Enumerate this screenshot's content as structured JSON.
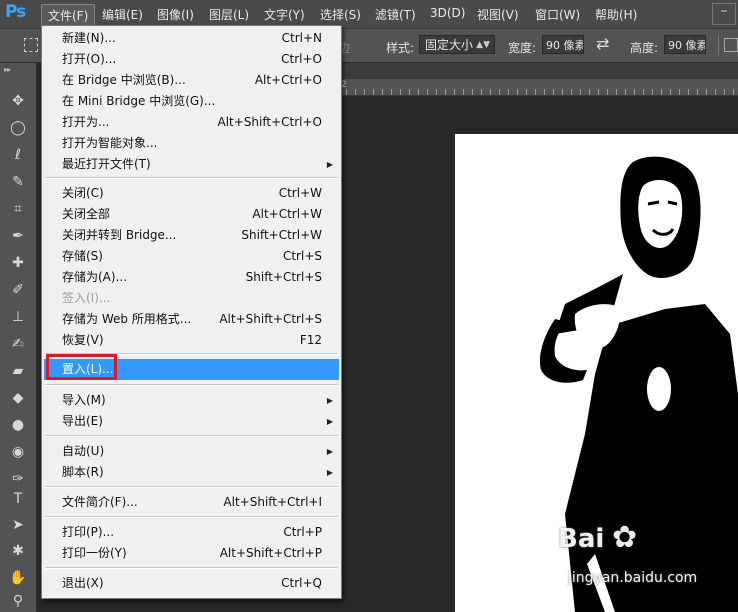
{
  "app": {
    "logo": "Ps"
  },
  "menubar": {
    "file": "文件(F)",
    "edit": "编辑(E)",
    "image": "图像(I)",
    "layer": "图层(L)",
    "type": "文字(Y)",
    "select": "选择(S)",
    "filter": "滤镜(T)",
    "threed": "3D(D)",
    "view": "视图(V)",
    "window": "窗口(W)",
    "help": "帮助(H)"
  },
  "options": {
    "refine_edge_partial": "边",
    "style_label": "样式:",
    "style_value": "固定大小",
    "width_label": "宽度:",
    "width_value": "90 像素",
    "height_label": "高度:",
    "height_value": "90 像素"
  },
  "file_menu": {
    "items": [
      {
        "label": "新建(N)...",
        "shortcut": "Ctrl+N"
      },
      {
        "label": "打开(O)...",
        "shortcut": "Ctrl+O"
      },
      {
        "label": "在 Bridge 中浏览(B)...",
        "shortcut": "Alt+Ctrl+O"
      },
      {
        "label": "在 Mini Bridge 中浏览(G)...",
        "shortcut": ""
      },
      {
        "label": "打开为...",
        "shortcut": "Alt+Shift+Ctrl+O"
      },
      {
        "label": "打开为智能对象...",
        "shortcut": ""
      },
      {
        "label": "最近打开文件(T)",
        "shortcut": ""
      },
      {
        "label": "关闭(C)",
        "shortcut": "Ctrl+W"
      },
      {
        "label": "关闭全部",
        "shortcut": "Alt+Ctrl+W"
      },
      {
        "label": "关闭并转到 Bridge...",
        "shortcut": "Shift+Ctrl+W"
      },
      {
        "label": "存储(S)",
        "shortcut": "Ctrl+S"
      },
      {
        "label": "存储为(A)...",
        "shortcut": "Shift+Ctrl+S"
      },
      {
        "label": "签入(I)...",
        "shortcut": ""
      },
      {
        "label": "存储为 Web 所用格式...",
        "shortcut": "Alt+Shift+Ctrl+S"
      },
      {
        "label": "恢复(V)",
        "shortcut": "F12"
      },
      {
        "label": "置入(L)...",
        "shortcut": ""
      },
      {
        "label": "导入(M)",
        "shortcut": ""
      },
      {
        "label": "导出(E)",
        "shortcut": ""
      },
      {
        "label": "自动(U)",
        "shortcut": ""
      },
      {
        "label": "脚本(R)",
        "shortcut": ""
      },
      {
        "label": "文件简介(F)...",
        "shortcut": "Alt+Shift+Ctrl+I"
      },
      {
        "label": "打印(P)...",
        "shortcut": "Ctrl+P"
      },
      {
        "label": "打印一份(Y)",
        "shortcut": "Alt+Shift+Ctrl+P"
      },
      {
        "label": "退出(X)",
        "shortcut": "Ctrl+Q"
      }
    ]
  },
  "ruler": {
    "start_label": "2"
  },
  "watermark": {
    "logo": "Bai",
    "paw": "du",
    "url": "jingyan.baidu.com"
  },
  "colors": {
    "highlight": "#3399ff",
    "annotation_box": "#d81b2b"
  }
}
